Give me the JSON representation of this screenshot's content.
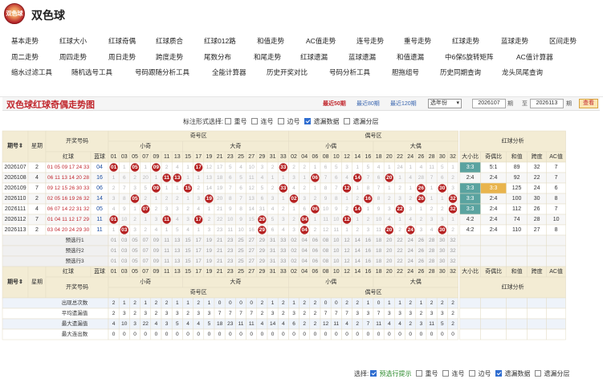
{
  "brand": {
    "logo_text": "双色球",
    "title": "双色球"
  },
  "nav": [
    [
      "基本走势",
      "红球大小",
      "红球奇偶",
      "红球质合",
      "红球012路",
      "和值走势",
      "AC值走势",
      "连号走势",
      "重号走势",
      "红球走势",
      "蓝球走势",
      "区间走势"
    ],
    [
      "周二走势",
      "周四走势",
      "周日走势",
      "跨度走势",
      "尾数分布",
      "和尾走势",
      "红球遗漏",
      "蓝球遗漏",
      "和值遗漏",
      "中6保5旋转矩阵",
      "AC值计算器"
    ],
    [
      "缩水过滤工具",
      "随机选号工具",
      "号码跟随分析工具",
      "全能计算器",
      "历史开奖对比",
      "号码分析工具",
      "胆拖组号",
      "历史同期查询",
      "龙头凤尾查询"
    ]
  ],
  "header": {
    "title": "双色球红球奇偶走势图",
    "recent50": "最近50期",
    "recent80": "最近80期",
    "recent120": "最近120期",
    "select": "选年份",
    "from": "2026107",
    "to_label": "至",
    "to": "2026113",
    "qi": "期",
    "query": "查看"
  },
  "mode": {
    "label": "标注形式选择:",
    "options": [
      {
        "t": "重号",
        "c": false
      },
      {
        "t": "连号",
        "c": false
      },
      {
        "t": "边号",
        "c": false
      },
      {
        "t": "遗漏数据",
        "c": true
      },
      {
        "t": "遗漏分层",
        "c": false
      }
    ]
  },
  "table": {
    "h_issue": "期号⇕",
    "h_week": "星期",
    "h_draw": "开奖号码",
    "h_red": "红球",
    "h_blue": "蓝球",
    "h_odd": "奇号区",
    "h_small_odd": "小奇",
    "h_big_odd": "大奇",
    "h_even": "偶号区",
    "h_small_even": "小偶",
    "h_big_even": "大偶",
    "h_ana": "红球分析",
    "h_ana_cols": [
      "大小比",
      "奇偶比",
      "和值",
      "跨度",
      "AC值"
    ],
    "odd_nums": [
      "01",
      "03",
      "05",
      "07",
      "09",
      "11",
      "13",
      "15",
      "17",
      "19",
      "21",
      "23",
      "25",
      "27",
      "29",
      "31",
      "33"
    ],
    "even_nums": [
      "02",
      "04",
      "06",
      "08",
      "10",
      "12",
      "14",
      "16",
      "18",
      "20",
      "22",
      "24",
      "26",
      "28",
      "30",
      "32"
    ],
    "rows": [
      {
        "issue": "2026107",
        "week": "2",
        "red": "01 05 09 17 24 33",
        "blue": "04",
        "odd": [
          "01",
          "1",
          "05",
          "1",
          "09",
          "2",
          "4",
          "1",
          "17",
          "12",
          "17",
          "5",
          "4",
          "10",
          "3",
          "2",
          "33"
        ],
        "even": [
          "2",
          "2",
          "1",
          "6",
          "5",
          "3",
          "1",
          "5",
          "4",
          "1",
          "24",
          "1",
          "4",
          "11",
          "5",
          "1"
        ],
        "ana": [
          "3:3",
          "5:1",
          "89",
          "32",
          "7"
        ]
      },
      {
        "issue": "2026108",
        "week": "4",
        "red": "06 11 13 14 20 28",
        "blue": "16",
        "odd": [
          "1",
          "6",
          "2",
          "20",
          "1",
          "11",
          "13",
          "1",
          "1",
          "13",
          "18",
          "6",
          "5",
          "11",
          "4",
          "1",
          "1"
        ],
        "even": [
          "3",
          "1",
          "06",
          "7",
          "6",
          "4",
          "14",
          "7",
          "6",
          "20",
          "1",
          "4",
          "28",
          "7",
          "6",
          "2"
        ],
        "ana": [
          "2:4",
          "2:4",
          "92",
          "22",
          "7"
        ]
      },
      {
        "issue": "2026109",
        "week": "7",
        "red": "09 12 15 26 30 33",
        "blue": "06",
        "odd": [
          "2",
          "7",
          "3",
          "5",
          "09",
          "1",
          "1",
          "15",
          "2",
          "14",
          "19",
          "7",
          "6",
          "12",
          "5",
          "2",
          "33"
        ],
        "even": [
          "4",
          "2",
          "1",
          "8",
          "7",
          "12",
          "1",
          "8",
          "7",
          "1",
          "2",
          "1",
          "26",
          "1",
          "30",
          "3"
        ],
        "ana": [
          "3:3",
          "3:3",
          "125",
          "24",
          "6"
        ]
      },
      {
        "issue": "2026110",
        "week": "2",
        "red": "02 05 16 19 26 32",
        "blue": "14",
        "odd": [
          "3",
          "8",
          "05",
          "2",
          "1",
          "2",
          "2",
          "1",
          "3",
          "19",
          "20",
          "8",
          "7",
          "13",
          "6",
          "3",
          "1"
        ],
        "even": [
          "02",
          "3",
          "2",
          "9",
          "8",
          "1",
          "2",
          "16",
          "8",
          "2",
          "3",
          "2",
          "26",
          "1",
          "1",
          "32"
        ],
        "ana": [
          "3:3",
          "2:4",
          "100",
          "30",
          "8"
        ]
      },
      {
        "issue": "2026111",
        "week": "4",
        "red": "06 07 14 22 31 32",
        "blue": "05",
        "odd": [
          "4",
          "9",
          "1",
          "07",
          "2",
          "3",
          "3",
          "2",
          "4",
          "1",
          "21",
          "9",
          "8",
          "14",
          "31",
          "4",
          "2"
        ],
        "even": [
          "1",
          "6",
          "06",
          "10",
          "9",
          "2",
          "14",
          "1",
          "9",
          "3",
          "22",
          "3",
          "1",
          "2",
          "2",
          "32"
        ],
        "ana": [
          "3:3",
          "2:4",
          "112",
          "26",
          "7"
        ]
      },
      {
        "issue": "2026112",
        "week": "7",
        "red": "01 04 11 12 17 29",
        "blue": "11",
        "odd": [
          "01",
          "10",
          "2",
          "1",
          "3",
          "11",
          "4",
          "3",
          "17",
          "2",
          "22",
          "10",
          "9",
          "15",
          "29",
          "5",
          "3"
        ],
        "even": [
          "2",
          "04",
          "1",
          "11",
          "10",
          "12",
          "1",
          "2",
          "10",
          "4",
          "1",
          "4",
          "2",
          "3",
          "3",
          "1"
        ],
        "ana": [
          "4:2",
          "2:4",
          "74",
          "28",
          "10"
        ]
      },
      {
        "issue": "2026113",
        "week": "2",
        "red": "03 04 20 24 29 30",
        "blue": "11",
        "odd": [
          "1",
          "03",
          "3",
          "2",
          "4",
          "1",
          "5",
          "4",
          "1",
          "3",
          "23",
          "11",
          "10",
          "16",
          "29",
          "6",
          "4"
        ],
        "even": [
          "3",
          "04",
          "2",
          "12",
          "11",
          "1",
          "2",
          "3",
          "11",
          "20",
          "2",
          "24",
          "3",
          "4",
          "30",
          "2"
        ],
        "ana": [
          "4:2",
          "2:4",
          "110",
          "27",
          "8"
        ]
      }
    ],
    "pre": [
      "预选行1",
      "预选行2",
      "预选行3"
    ],
    "stats": [
      {
        "label": "出现总次数",
        "odd": [
          "2",
          "1",
          "2",
          "1",
          "2",
          "2",
          "1",
          "1",
          "2",
          "1",
          "0",
          "0",
          "0",
          "0",
          "2",
          "1",
          "2"
        ],
        "even": [
          "1",
          "2",
          "2",
          "0",
          "0",
          "2",
          "2",
          "1",
          "0",
          "1",
          "1",
          "2",
          "1",
          "2",
          "2",
          "2"
        ]
      },
      {
        "label": "平均遗漏值",
        "odd": [
          "2",
          "3",
          "2",
          "3",
          "2",
          "3",
          "3",
          "2",
          "3",
          "3",
          "7",
          "7",
          "7",
          "7",
          "2",
          "3",
          "2"
        ],
        "even": [
          "3",
          "2",
          "2",
          "7",
          "7",
          "7",
          "3",
          "3",
          "7",
          "3",
          "3",
          "3",
          "2",
          "3",
          "3",
          "2"
        ]
      },
      {
        "label": "最大遗漏值",
        "odd": [
          "4",
          "10",
          "3",
          "22",
          "4",
          "3",
          "5",
          "4",
          "4",
          "5",
          "18",
          "23",
          "11",
          "11",
          "4",
          "14",
          "4"
        ],
        "even": [
          "6",
          "2",
          "2",
          "12",
          "11",
          "4",
          "2",
          "7",
          "11",
          "4",
          "4",
          "2",
          "3",
          "11",
          "5",
          "2"
        ]
      },
      {
        "label": "最大连出数",
        "odd": [
          "0",
          "0",
          "0",
          "0",
          "0",
          "0",
          "0",
          "0",
          "0",
          "0",
          "0",
          "0",
          "0",
          "0",
          "0",
          "0",
          "0"
        ],
        "even": [
          "0",
          "0",
          "0",
          "0",
          "0",
          "0",
          "0",
          "0",
          "0",
          "0",
          "0",
          "0",
          "0",
          "0",
          "0",
          "0"
        ]
      }
    ]
  },
  "footer": {
    "label": "选择:",
    "options": [
      {
        "t": "预选行提示",
        "c": true,
        "g": true
      },
      {
        "t": "重号",
        "c": false
      },
      {
        "t": "连号",
        "c": false
      },
      {
        "t": "边号",
        "c": false
      },
      {
        "t": "遗漏数据",
        "c": true
      },
      {
        "t": "遗漏分层",
        "c": false
      }
    ]
  },
  "colors": {
    "red": "#c1272d",
    "blue": "#1e4fa0",
    "ball": "#b52121",
    "teal": "#5aa3a0",
    "header": "#f3ecd4"
  }
}
